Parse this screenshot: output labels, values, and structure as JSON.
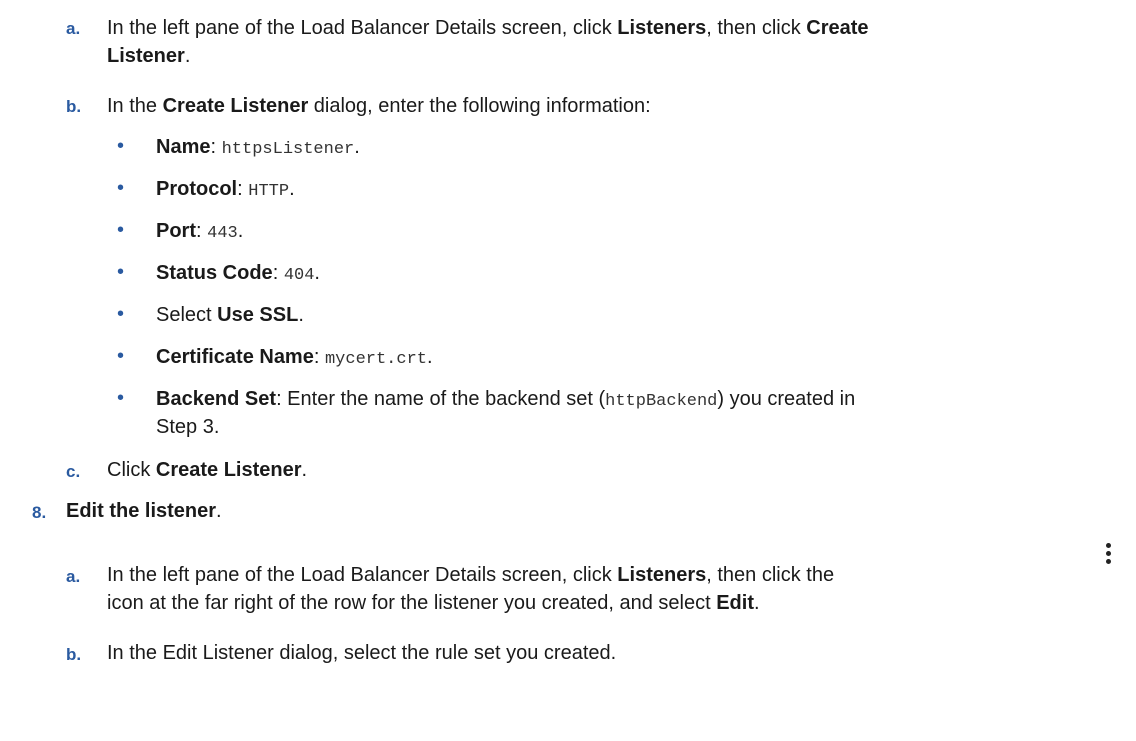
{
  "steps": {
    "step7_a": {
      "label": "a.",
      "text1": "In the left pane of the Load Balancer Details screen, click ",
      "bold1": "Listeners",
      "text2": ", then click ",
      "bold2": "Create",
      "line2_bold": "Listener",
      "line2_text": "."
    },
    "step7_b": {
      "label": "b.",
      "text1": "In the ",
      "bold1": "Create Listener",
      "text2": " dialog, enter the following information:"
    },
    "bullets": [
      {
        "bullet": "•",
        "bold": "Name",
        "sep": ": ",
        "code": "httpsListener",
        "end": "."
      },
      {
        "bullet": "•",
        "bold": "Protocol",
        "sep": ": ",
        "code": "HTTP",
        "end": "."
      },
      {
        "bullet": "•",
        "bold": "Port",
        "sep": ": ",
        "code": "443",
        "end": "."
      },
      {
        "bullet": "•",
        "bold": "Status Code",
        "sep": ": ",
        "code": "404",
        "end": "."
      },
      {
        "bullet": "•",
        "pre": "Select ",
        "bold": "Use SSL",
        "end": "."
      },
      {
        "bullet": "•",
        "bold": "Certificate Name",
        "sep": ": ",
        "code": "mycert.crt",
        "end": "."
      },
      {
        "bullet": "•",
        "bold": "Backend Set",
        "text1": ": Enter the name of the backend set (",
        "code": "httpBackend",
        "text2": ") you created in",
        "line2": "Step 3."
      }
    ],
    "step7_c": {
      "label": "c.",
      "text1": "Click ",
      "bold1": "Create Listener",
      "end": "."
    },
    "step8": {
      "label": "8.",
      "bold": "Edit the listener",
      "end": "."
    },
    "step8_a": {
      "label": "a.",
      "text1": "In the left pane of the Load Balancer Details screen, click ",
      "bold1": "Listeners",
      "text2": ", then click the",
      "line2_text1": "icon at the far right of the row for the listener you created, and select ",
      "line2_bold": "Edit",
      "line2_end": "."
    },
    "step8_b": {
      "label": "b.",
      "text": "In the Edit Listener dialog, select the rule set you created."
    }
  },
  "icons": {
    "kebab": "vertical-ellipsis-icon"
  }
}
